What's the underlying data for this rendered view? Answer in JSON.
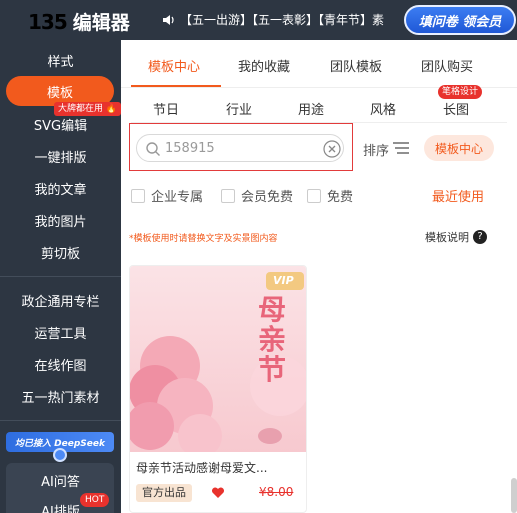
{
  "header": {
    "logo_mark": "135",
    "logo_text": "编辑器",
    "announcement": "【五一出游】【五一表彰】【青年节】素",
    "survey_button": "填问卷 领会员"
  },
  "sidebar": {
    "items": [
      {
        "label": "样式"
      },
      {
        "label": "模板",
        "badge": "大牌都在用"
      },
      {
        "label": "SVG编辑"
      },
      {
        "label": "一键排版"
      },
      {
        "label": "我的文章"
      },
      {
        "label": "我的图片"
      },
      {
        "label": "剪切板"
      }
    ],
    "items2": [
      {
        "label": "政企通用专栏"
      },
      {
        "label": "运营工具"
      },
      {
        "label": "在线作图"
      },
      {
        "label": "五一热门素材"
      }
    ],
    "deepseek_banner": "均已接入 DeepSeek",
    "ai_label": "AI问答",
    "ai_label2": "AI排版",
    "hot_badge": "HOT"
  },
  "tabs": [
    {
      "label": "模板中心",
      "active": true
    },
    {
      "label": "我的收藏"
    },
    {
      "label": "团队模板"
    },
    {
      "label": "团队购买"
    }
  ],
  "categories": [
    {
      "label": "节日"
    },
    {
      "label": "行业"
    },
    {
      "label": "用途"
    },
    {
      "label": "风格"
    },
    {
      "label": "长图",
      "badge": "笔格设计"
    }
  ],
  "search": {
    "value": "158915"
  },
  "sort": {
    "label": "排序",
    "center_label": "模板中心"
  },
  "filters": [
    {
      "label": "企业专属"
    },
    {
      "label": "会员免费"
    },
    {
      "label": "免费"
    }
  ],
  "recent_label": "最近使用",
  "tip": "*模板使用时请替换文字及实景图内容",
  "help_label": "模板说明",
  "card": {
    "vip": "VIP",
    "image_text": [
      "母",
      "亲",
      "节"
    ],
    "title": "母亲节活动感谢母爱文...",
    "badge": "官方出品",
    "price": "¥8.00"
  },
  "colors": {
    "accent": "#f25a1d",
    "sidebar_bg": "#2d3642"
  }
}
